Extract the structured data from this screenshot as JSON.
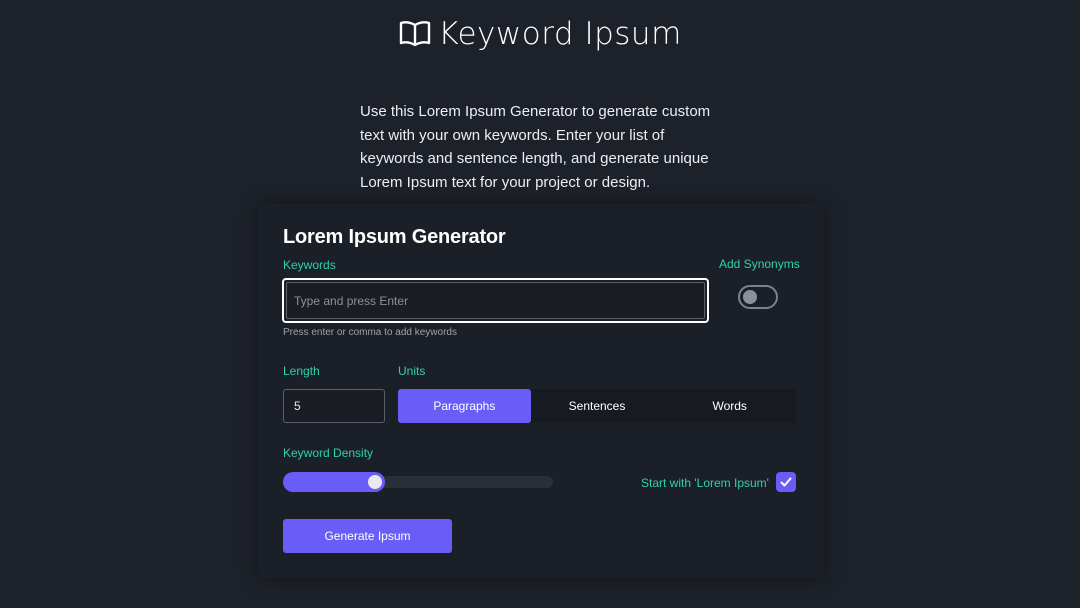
{
  "header": {
    "title": "Keyword Ipsum",
    "icon": "open-book-icon"
  },
  "intro": "Use this Lorem Ipsum Generator to generate custom text with your own keywords. Enter your list of keywords and sentence length, and generate unique Lorem Ipsum text for your project or design.",
  "generator": {
    "title": "Lorem Ipsum Generator",
    "keywords": {
      "label": "Keywords",
      "placeholder": "Type and press Enter",
      "value": "",
      "help": "Press enter or comma to add keywords"
    },
    "synonyms": {
      "label": "Add Synonyms",
      "enabled": false
    },
    "length": {
      "label": "Length",
      "value": "5"
    },
    "units": {
      "label": "Units",
      "options": [
        "Paragraphs",
        "Sentences",
        "Words"
      ],
      "selected": "Paragraphs"
    },
    "density": {
      "label": "Keyword Density",
      "value": 0.35
    },
    "start_with": {
      "label": "Start with 'Lorem Ipsum'",
      "checked": true
    },
    "generate_label": "Generate Ipsum"
  },
  "colors": {
    "accent": "#6a5cf6",
    "label": "#2ed3a8",
    "background": "#1d2129"
  }
}
